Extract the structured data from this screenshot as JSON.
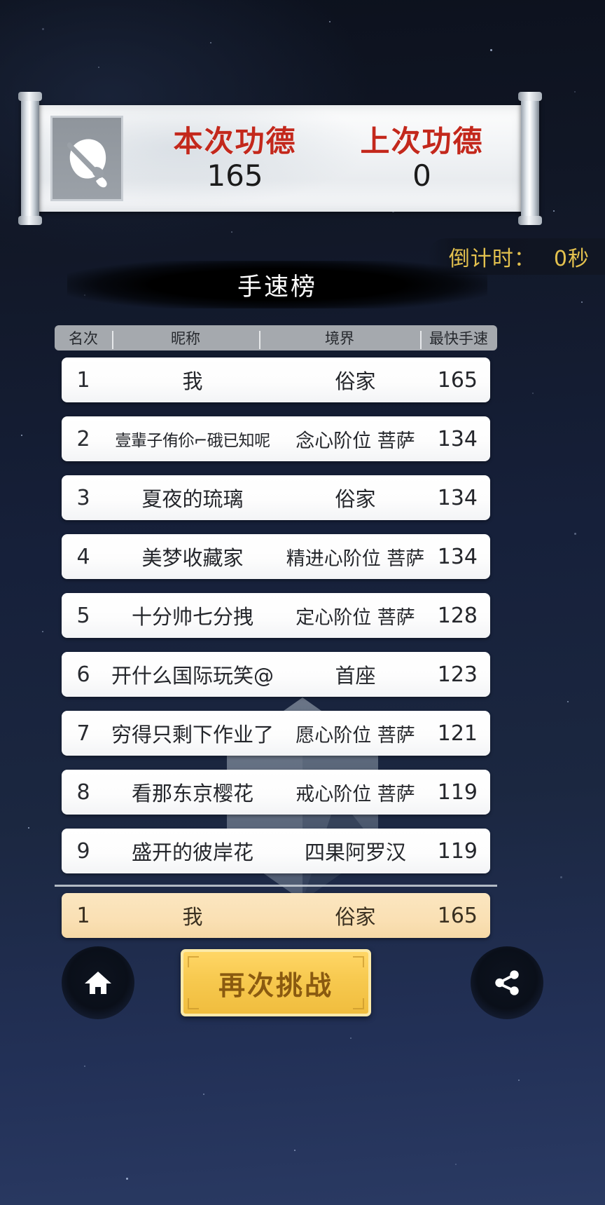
{
  "merit": {
    "icon": "wooden-fish-icon",
    "this_label": "本次功德",
    "this_value": "165",
    "last_label": "上次功德",
    "last_value": "0"
  },
  "countdown": {
    "label": "倒计时：",
    "value": "0秒"
  },
  "board": {
    "title": "手速榜",
    "headers": {
      "rank": "名次",
      "nickname": "昵称",
      "realm": "境界",
      "speed": "最快手速"
    },
    "rows": [
      {
        "rank": "1",
        "nickname": "我",
        "realm": "俗家",
        "speed": "165"
      },
      {
        "rank": "2",
        "nickname": "壹輩子侑伱⌐硪已知呢",
        "realm": "念心阶位 菩萨",
        "speed": "134"
      },
      {
        "rank": "3",
        "nickname": "夏夜的琉璃",
        "realm": "俗家",
        "speed": "134"
      },
      {
        "rank": "4",
        "nickname": "美梦收藏家",
        "realm": "精进心阶位 菩萨",
        "speed": "134"
      },
      {
        "rank": "5",
        "nickname": "十分帅七分拽",
        "realm": "定心阶位 菩萨",
        "speed": "128"
      },
      {
        "rank": "6",
        "nickname": "开什么国际玩笑@",
        "realm": "首座",
        "speed": "123"
      },
      {
        "rank": "7",
        "nickname": "穷得只剩下作业了",
        "realm": "愿心阶位 菩萨",
        "speed": "121"
      },
      {
        "rank": "8",
        "nickname": "看那东京樱花",
        "realm": "戒心阶位 菩萨",
        "speed": "119"
      },
      {
        "rank": "9",
        "nickname": "盛开的彼岸花",
        "realm": "四果阿罗汉",
        "speed": "119"
      }
    ],
    "my_row": {
      "rank": "1",
      "nickname": "我",
      "realm": "俗家",
      "speed": "165"
    }
  },
  "bottom": {
    "home_icon": "home-icon",
    "challenge_label": "再次挑战",
    "share_icon": "share-icon"
  },
  "colors": {
    "merit_label": "#c3281c",
    "countdown": "#e3c14e",
    "my_row_bg": "#fae0b4",
    "challenge_bg": "#f7c94f",
    "challenge_text": "#8a5a10"
  }
}
